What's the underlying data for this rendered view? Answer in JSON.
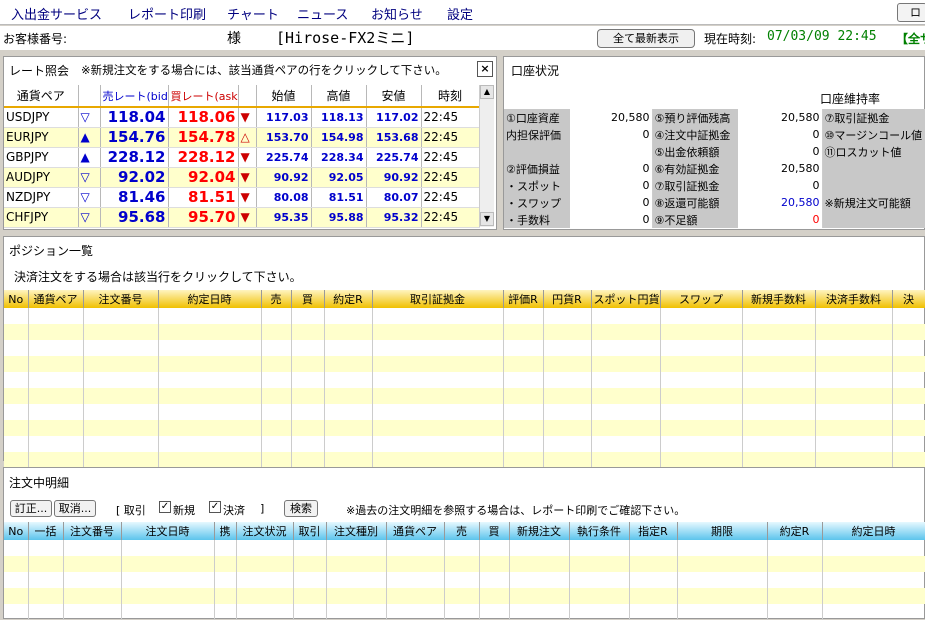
{
  "menu": [
    "入出金サービス",
    "レポート印刷",
    "チャート",
    "ニュース",
    "お知らせ",
    "設定"
  ],
  "menu_right": "ロ",
  "customer": {
    "label": "お客様番号:",
    "sama": "様",
    "brand": "[Hirose-FX2ミニ]"
  },
  "refresh_button": "全て最新表示",
  "time": {
    "label": "現在時刻:",
    "value": "07/03/09 22:45",
    "extra": "【全サ"
  },
  "rate": {
    "title": "レート照会",
    "note": "※新規注文をする場合には、該当通貨ペアの行をクリックして下さい。",
    "close": "×",
    "headers": [
      "通貨ペア",
      "",
      "売レート(bid)",
      "買レート(ask)",
      "",
      "始値",
      "高値",
      "安値",
      "時刻"
    ],
    "rows": [
      {
        "pair": "USDJPY",
        "bid_arrow": "▽",
        "bid": "118.04",
        "ask": "118.06",
        "ask_arrow": "▼",
        "open": "117.03",
        "high": "118.13",
        "low": "117.02",
        "time": "22:45"
      },
      {
        "pair": "EURJPY",
        "bid_arrow": "▲",
        "bid": "154.76",
        "ask": "154.78",
        "ask_arrow": "△",
        "open": "153.70",
        "high": "154.98",
        "low": "153.68",
        "time": "22:45"
      },
      {
        "pair": "GBPJPY",
        "bid_arrow": "▲",
        "bid": "228.12",
        "ask": "228.12",
        "ask_arrow": "▼",
        "open": "225.74",
        "high": "228.34",
        "low": "225.74",
        "time": "22:45"
      },
      {
        "pair": "AUDJPY",
        "bid_arrow": "▽",
        "bid": "92.02",
        "ask": "92.04",
        "ask_arrow": "▼",
        "open": "90.92",
        "high": "92.05",
        "low": "90.92",
        "time": "22:45"
      },
      {
        "pair": "NZDJPY",
        "bid_arrow": "▽",
        "bid": "81.46",
        "ask": "81.51",
        "ask_arrow": "▼",
        "open": "80.08",
        "high": "81.51",
        "low": "80.07",
        "time": "22:45"
      },
      {
        "pair": "CHFJPY",
        "bid_arrow": "▽",
        "bid": "95.68",
        "ask": "95.70",
        "ask_arrow": "▼",
        "open": "95.35",
        "high": "95.88",
        "low": "95.32",
        "time": "22:45"
      }
    ]
  },
  "account": {
    "title": "口座状況",
    "maintenance": "口座維持率",
    "rows": [
      {
        "l1": "①口座資産",
        "v1": "20,580",
        "l2": "⑤預り評価残高",
        "v2": "20,580",
        "l3": "⑦取引証拠金"
      },
      {
        "l1": "内担保評価",
        "v1": "0",
        "l2": "④注文中証拠金",
        "v2": "0",
        "l3": "⑩マージンコール値"
      },
      {
        "l1": "",
        "v1": "",
        "l2": "⑤出金依頼額",
        "v2": "0",
        "l3": "⑪ロスカット値"
      },
      {
        "l1": "②評価損益",
        "v1": "0",
        "l2": "⑥有効証拠金",
        "v2": "20,580",
        "l3": ""
      },
      {
        "l1": "・スポット",
        "v1": "0",
        "l2": "⑦取引証拠金",
        "v2": "0",
        "l3": ""
      },
      {
        "l1": "・スワップ",
        "v1": "0",
        "l2": "⑧返還可能額",
        "v2": "20,580",
        "l3": "※新規注文可能額"
      },
      {
        "l1": "・手数料",
        "v1": "0",
        "l2": "⑨不足額",
        "v2": "0",
        "l3": ""
      }
    ]
  },
  "positions": {
    "title": "ポジション一覧",
    "note": "決済注文をする場合は該当行をクリックして下さい。",
    "headers": [
      "No",
      "通貨ペア",
      "注文番号",
      "約定日時",
      "売",
      "買",
      "約定R",
      "取引証拠金",
      "評価R",
      "円貨R",
      "スポット円貨",
      "スワップ",
      "新規手数料",
      "決済手数料",
      "決"
    ]
  },
  "orders": {
    "title": "注文中明細",
    "btn_modify": "訂正...",
    "btn_cancel": "取消...",
    "filter_label": "[ 取引",
    "chk_new": "新規",
    "chk_close": "決済",
    "filter_end": "]",
    "btn_search": "検索",
    "note": "※過去の注文明細を参照する場合は、レポート印刷でご確認下さい。",
    "headers": [
      "No",
      "一括",
      "注文番号",
      "注文日時",
      "携",
      "注文状況",
      "取引",
      "注文種別",
      "通貨ペア",
      "売",
      "買",
      "新規注文",
      "執行条件",
      "指定R",
      "期限",
      "約定R",
      "約定日時"
    ]
  }
}
